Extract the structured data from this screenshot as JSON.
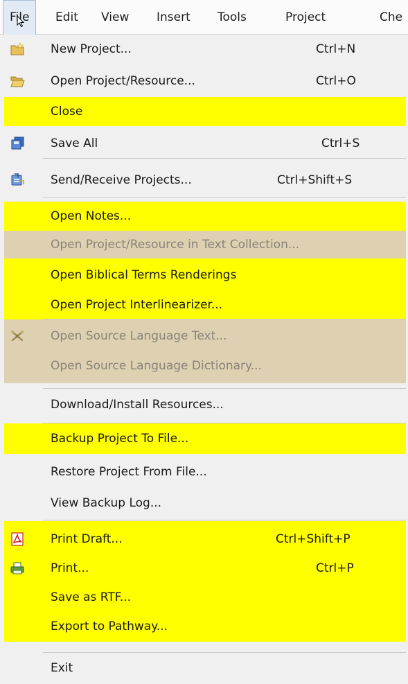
{
  "menubar": {
    "items": [
      "File",
      "Edit",
      "View",
      "Insert",
      "Tools",
      "Project",
      "Che"
    ]
  },
  "menu": {
    "items": [
      {
        "label": "New Project...",
        "shortcut": "Ctrl+N",
        "icon": "folder-new-icon",
        "state": "normal"
      },
      {
        "label": "Open Project/Resource...",
        "shortcut": "Ctrl+O",
        "icon": "folder-open-icon",
        "state": "normal"
      },
      {
        "label": "Close",
        "shortcut": "",
        "icon": "",
        "state": "highlighted"
      },
      {
        "label": "Save All",
        "shortcut": "Ctrl+S",
        "icon": "save-all-icon",
        "state": "normal"
      },
      {
        "label": "Send/Receive Projects...",
        "shortcut": "Ctrl+Shift+S",
        "icon": "send-receive-icon",
        "state": "normal"
      },
      {
        "label": "Open Notes...",
        "shortcut": "",
        "icon": "",
        "state": "highlighted"
      },
      {
        "label": "Open Project/Resource in Text Collection...",
        "shortcut": "",
        "icon": "",
        "state": "disabled"
      },
      {
        "label": "Open Biblical Terms Renderings",
        "shortcut": "",
        "icon": "",
        "state": "highlighted"
      },
      {
        "label": "Open Project Interlinearizer...",
        "shortcut": "",
        "icon": "",
        "state": "highlighted"
      },
      {
        "label": "Open Source Language Text...",
        "shortcut": "",
        "icon": "source-language-icon",
        "state": "disabled"
      },
      {
        "label": "Open Source Language Dictionary...",
        "shortcut": "",
        "icon": "",
        "state": "disabled"
      },
      {
        "label": "Download/Install Resources...",
        "shortcut": "",
        "icon": "",
        "state": "normal"
      },
      {
        "label": "Backup Project To File...",
        "shortcut": "",
        "icon": "",
        "state": "highlighted"
      },
      {
        "label": "Restore Project From File...",
        "shortcut": "",
        "icon": "",
        "state": "normal"
      },
      {
        "label": "View Backup Log...",
        "shortcut": "",
        "icon": "",
        "state": "normal"
      },
      {
        "label": "Print Draft...",
        "shortcut": "Ctrl+Shift+P",
        "icon": "pdf-icon",
        "state": "highlighted"
      },
      {
        "label": "Print...",
        "shortcut": "Ctrl+P",
        "icon": "printer-icon",
        "state": "highlighted"
      },
      {
        "label": "Save as RTF...",
        "shortcut": "",
        "icon": "",
        "state": "highlighted"
      },
      {
        "label": "Export to Pathway...",
        "shortcut": "",
        "icon": "",
        "state": "highlighted"
      },
      {
        "label": "Exit",
        "shortcut": "",
        "icon": "",
        "state": "normal"
      }
    ]
  },
  "colors": {
    "highlight": "#ffff00",
    "disabled_band": "#ddd1b2",
    "menu_background": "#f0f0f0"
  }
}
